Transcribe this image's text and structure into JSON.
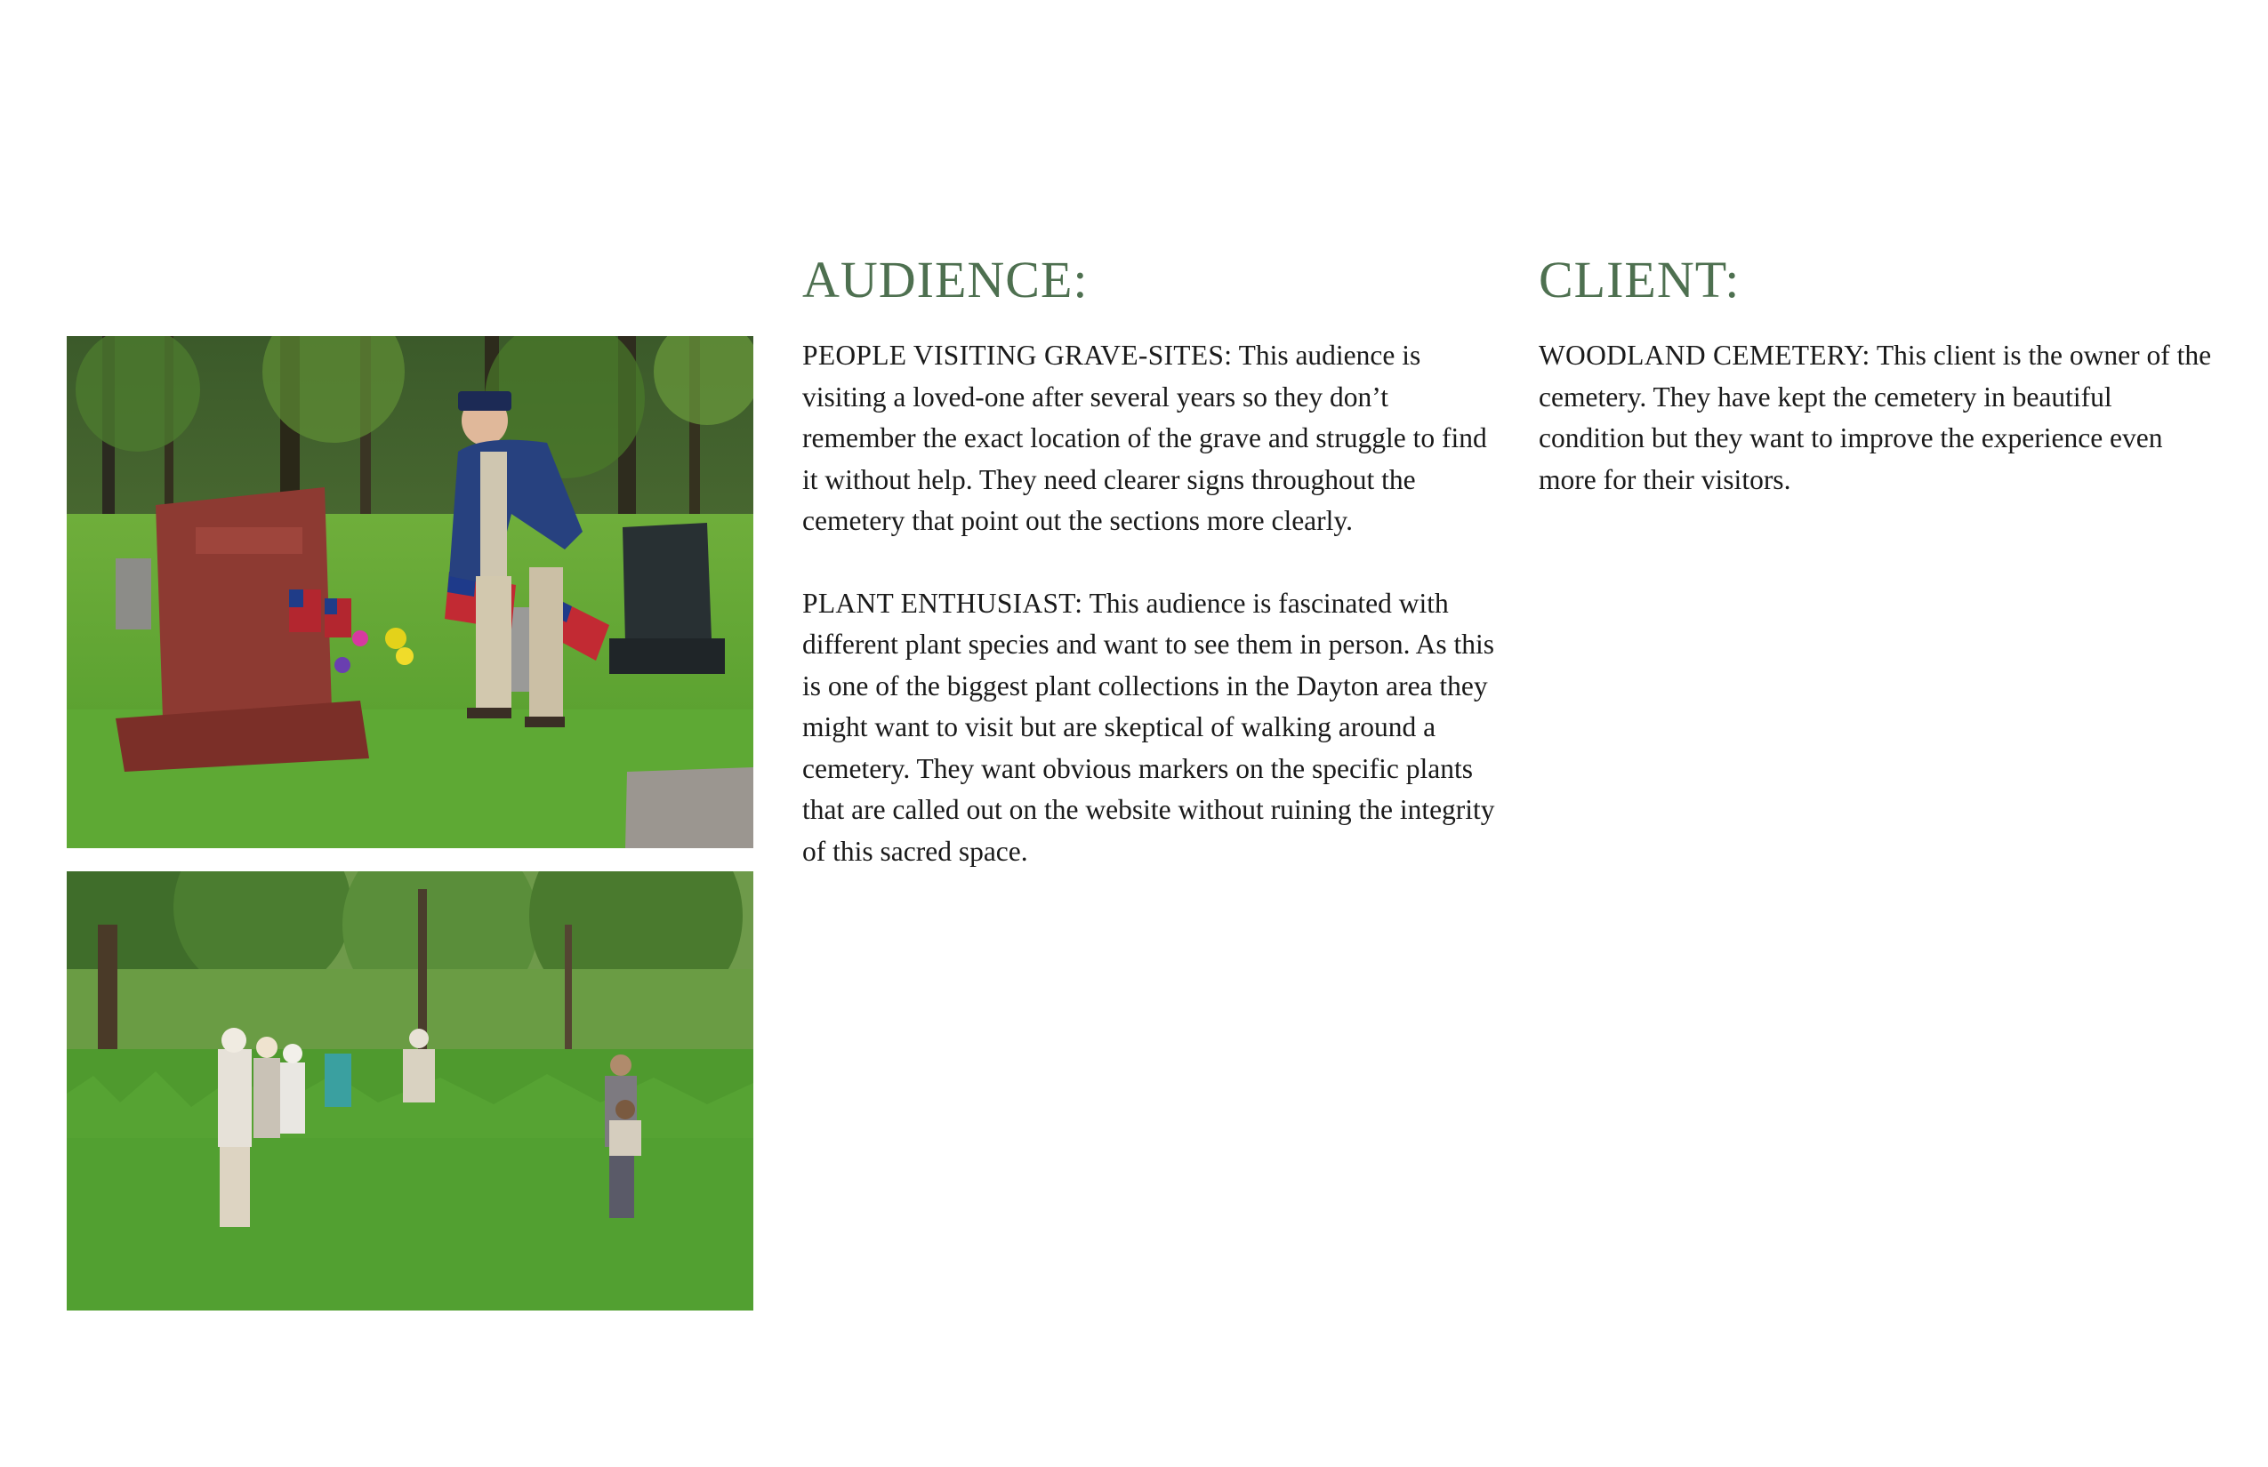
{
  "photos": {
    "grave_visit": {
      "alt": "graves-icon"
    },
    "plant_walk": {
      "alt": "plants-icon"
    }
  },
  "audience": {
    "heading": "AUDIENCE:",
    "items": [
      {
        "lead": "PEOPLE VISITING GRAVE-SITES:",
        "text": " This audience is visiting a loved-one after several years so they don’t remember the exact location of the grave and struggle to find it without help. They need clearer signs throughout the cemetery that point out the sections more clearly."
      },
      {
        "lead": "PLANT ENTHUSIAST:",
        "text": " This audience is fascinated with different plant species and want to see them in person. As this is one of the biggest plant collections in the Dayton area they might want to visit but are skeptical of walking around a cemetery. They want obvious markers on the specific plants that are called out on the website without ruining the integrity of this sacred space."
      }
    ]
  },
  "client": {
    "heading": "CLIENT:",
    "items": [
      {
        "lead": "WOODLAND CEMETERY:",
        "text": " This client is the owner of the cemetery. They have kept the cemetery in beautiful condition but they want to improve the experience even more for their visitors."
      }
    ]
  },
  "colors": {
    "heading": "#4e7050",
    "body": "#1a1a1a"
  }
}
